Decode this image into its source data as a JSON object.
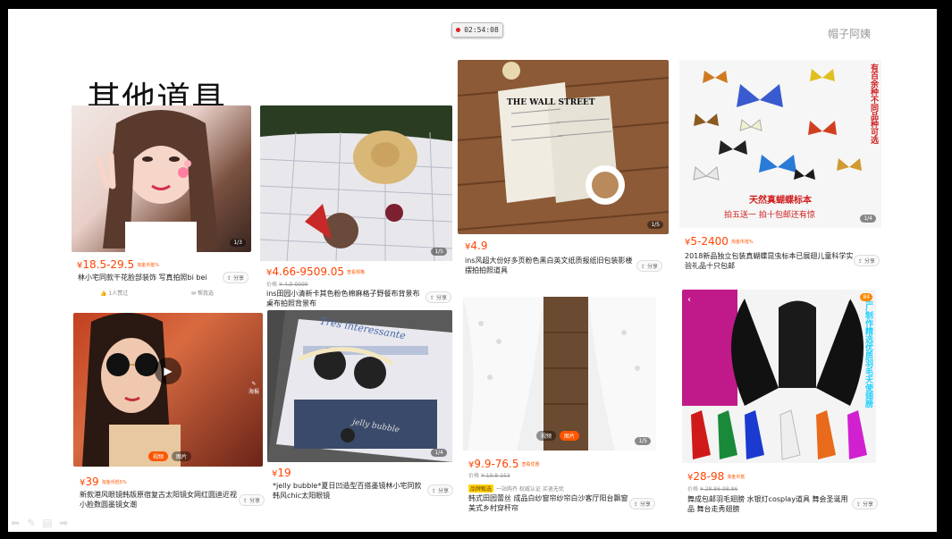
{
  "timer": "02:54:08",
  "brand": "帽子阿姨",
  "title": "其他道具",
  "products": [
    {
      "price_sym": "¥",
      "price": "18.5-29.5",
      "tag": "淘金币抵%",
      "orig": "",
      "desc": "林小宅同款干花脸部装饰 写真拍照bi bei",
      "share": "分享",
      "img_count": "1/3",
      "likes": "1人赞过",
      "meta2": "帮我选"
    },
    {
      "price_sym": "¥",
      "price": "4.66-9509.05",
      "tag": "查看规格",
      "orig_label": "价格",
      "orig": "¥ 4.9-9999",
      "desc": "ins田园小清新卡其色粉色棉麻格子野餐布背景布桌布拍照背景布",
      "share": "分享",
      "img_count": "1/5"
    },
    {
      "price_sym": "¥",
      "price": "4.9",
      "desc": "ins风超大份好多页粉色黑白英文纸质报纸旧包装影楼摆拍拍照道具",
      "share": "分享",
      "img_count": "1/5",
      "img_text": "THE WALL STREET"
    },
    {
      "price_sym": "¥",
      "price": "5-2400",
      "tag": "淘金币抵%",
      "desc": "2018新品独立包装真蝴蝶昆虫标本已展翅儿童科学实验礼品十只包邮",
      "share": "分享",
      "img_count": "1/4",
      "img_text_side": "有百余种不同品种可选",
      "img_text_bottom": "天然真蝴蝶标本",
      "img_text_bottom2": "拍五送一 拍十包邮还有惊"
    },
    {
      "price_sym": "¥",
      "price": "39",
      "tag": "淘金币抵5%",
      "desc": "新款港风眼镜韩版原宿复古太阳镜女网红圆迪近视小脸数圆墨镜女潮",
      "share": "分享",
      "video_label": "视频",
      "pic_label": "图片",
      "share_overlay": "海报"
    },
    {
      "price_sym": "¥",
      "price": "19",
      "desc": "*jelly bubble*夏日凹造型百搭墨镜林小宅同款韩风chic太阳眼镜",
      "share": "分享",
      "img_count": "1/4",
      "img_text": "Très intéressante",
      "img_text2": "jelly bubble"
    },
    {
      "price_sym": "¥",
      "price": "9.9-76.5",
      "tag": "查看优惠",
      "orig_label": "价格",
      "orig": "¥ 19.8-153",
      "badge": "品牌甄选",
      "meta": "一站购齐 权威认证 买退无忧",
      "desc": "韩式田园蕾丝 成品白纱窗帘纱帘白沙客厅阳台飘窗美式乡村穿杆帘",
      "share": "分享",
      "video_label": "视频",
      "pic_label": "图片",
      "img_count": "1/5"
    },
    {
      "price_sym": "¥",
      "price": "28-98",
      "tag": "淘金币抵",
      "orig_label": "价格",
      "orig": "¥ 28.86-98.86",
      "desc": "舞成包邮羽毛翅膀 水银灯cosplay道具 舞会圣诞用品 舞台走秀翅膀",
      "share": "分享",
      "img_text": "工厂制作精选优质羽毛天使翅膀",
      "img_count": "84"
    }
  ]
}
